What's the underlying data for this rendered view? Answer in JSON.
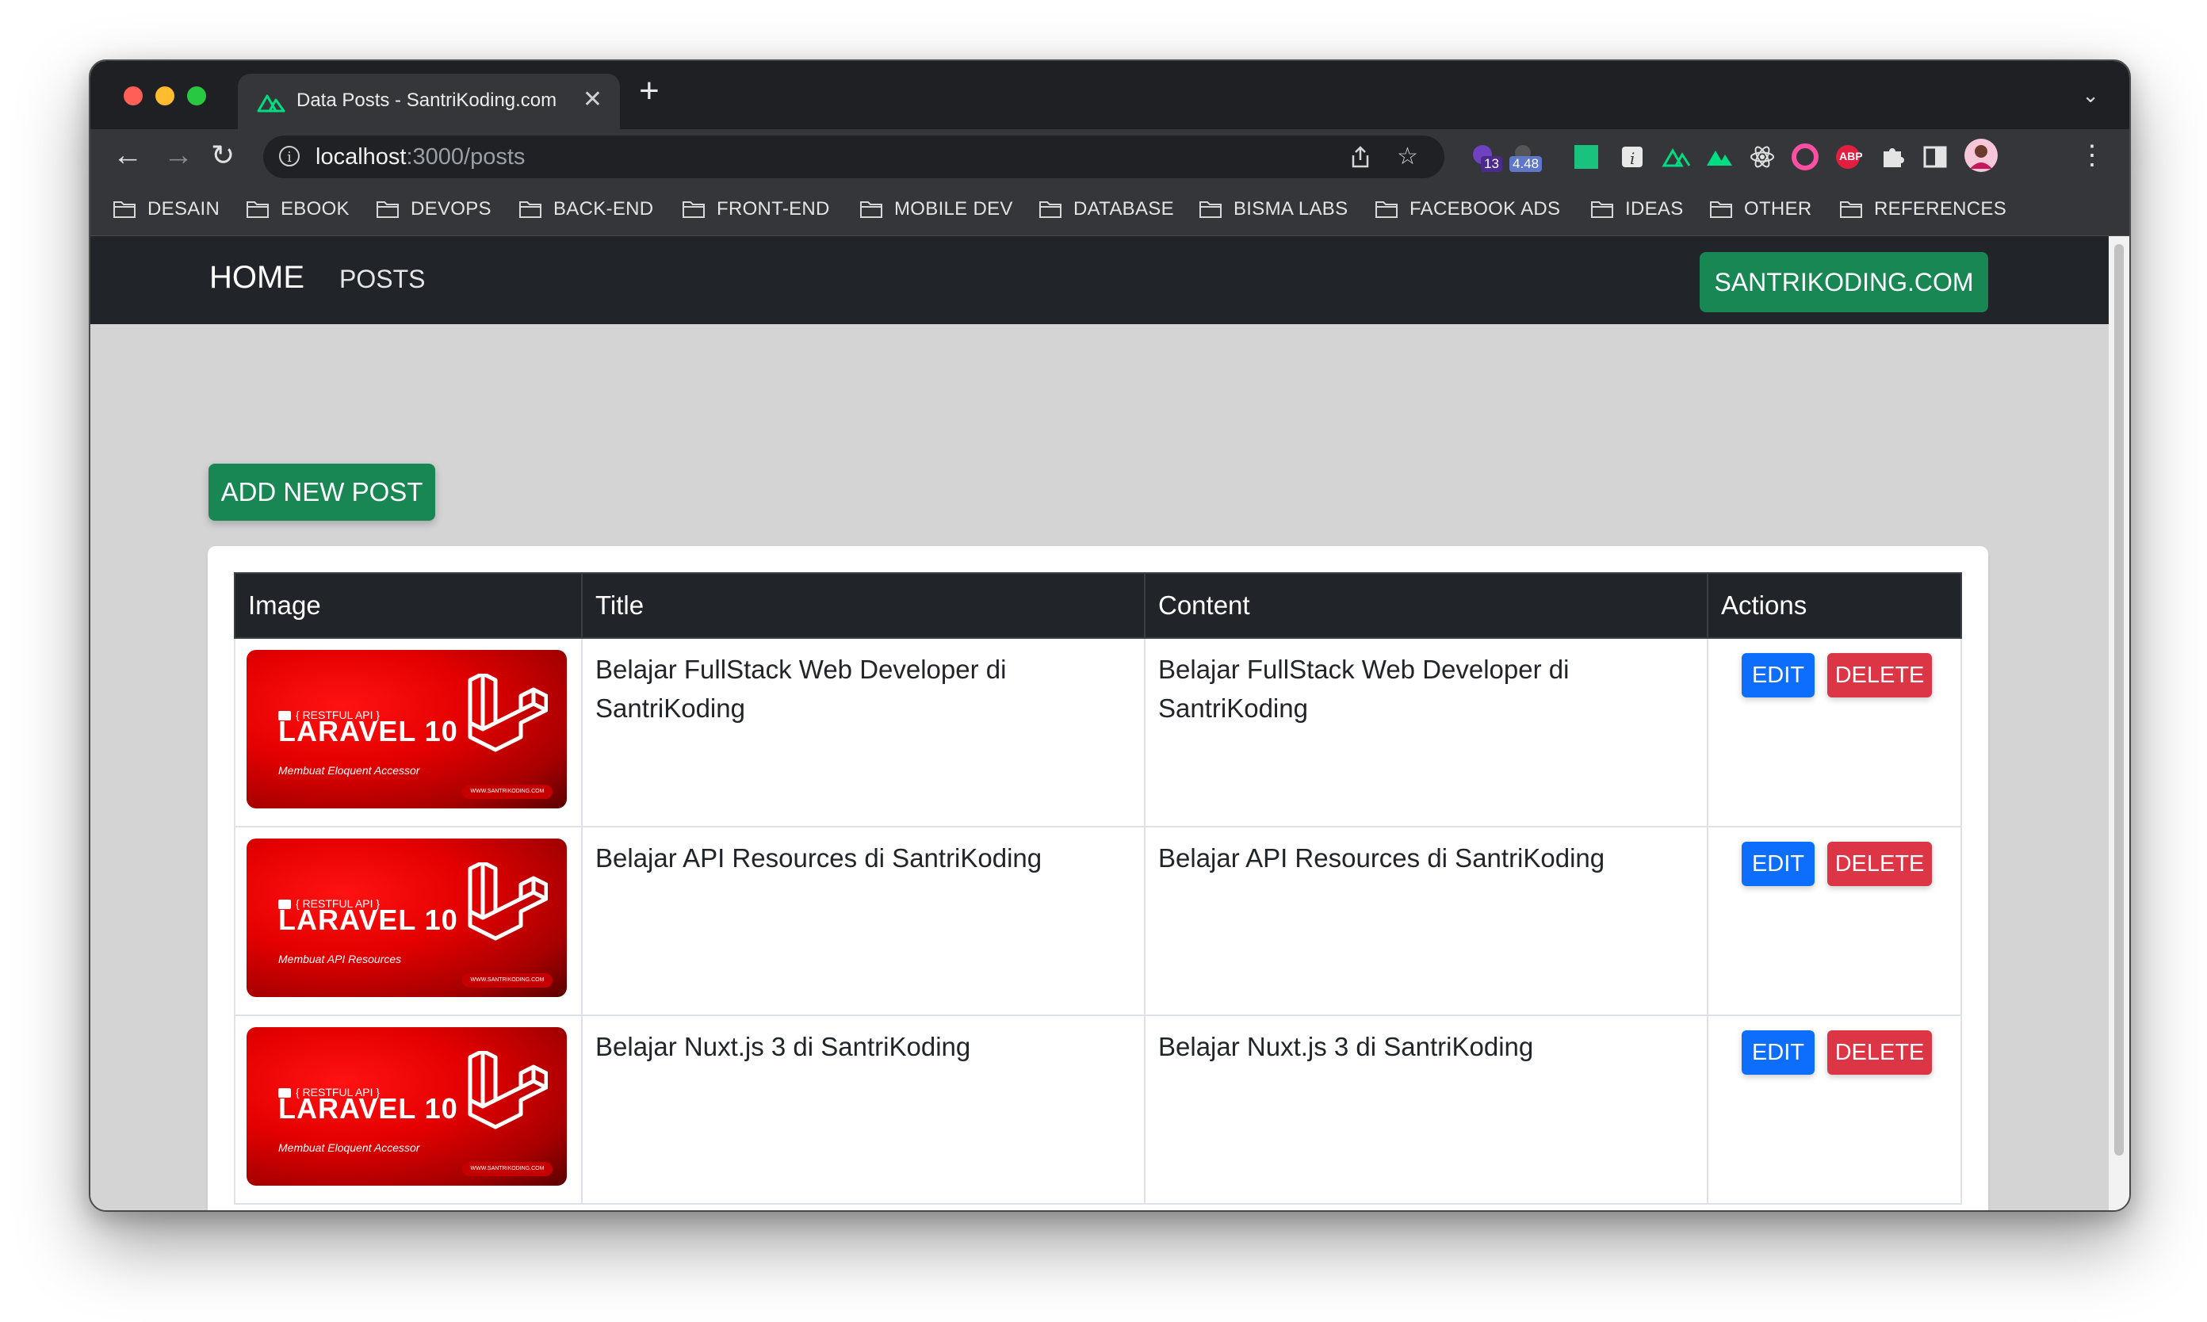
{
  "browser": {
    "tab_title": "Data Posts - SantriKoding.com",
    "tab_close": "✕",
    "new_tab": "+",
    "url_host": "localhost",
    "url_path": ":3000/posts",
    "extension_badge_count": "13",
    "extension_badge_value": "4.48",
    "abp_label": "ABP",
    "bookmarks": [
      "DESAIN",
      "EBOOK",
      "DEVOPS",
      "BACK-END",
      "FRONT-END",
      "MOBILE DEV",
      "DATABASE",
      "BISMA LABS",
      "FACEBOOK ADS",
      "IDEAS",
      "OTHER",
      "REFERENCES"
    ]
  },
  "nav": {
    "home": "HOME",
    "posts": "POSTS",
    "brand": "SANTRIKODING.COM"
  },
  "page": {
    "add_button": "ADD NEW POST"
  },
  "table": {
    "headers": [
      "Image",
      "Title",
      "Content",
      "Actions"
    ],
    "edit_label": "EDIT",
    "delete_label": "DELETE",
    "rows": [
      {
        "thumb_tag": "{ RESTFUL API }",
        "thumb_title": "LARAVEL 10",
        "thumb_sub": "Membuat Eloquent Accessor",
        "thumb_url": "WWW.SANTRIKODING.COM",
        "title": "Belajar FullStack Web Developer di SantriKoding",
        "content": "Belajar FullStack Web Developer di SantriKoding"
      },
      {
        "thumb_tag": "{ RESTFUL API }",
        "thumb_title": "LARAVEL 10",
        "thumb_sub": "Membuat API Resources",
        "thumb_url": "WWW.SANTRIKODING.COM",
        "title": "Belajar API Resources di SantriKoding",
        "content": "Belajar API Resources di SantriKoding"
      },
      {
        "thumb_tag": "{ RESTFUL API }",
        "thumb_title": "LARAVEL 10",
        "thumb_sub": "Membuat Eloquent Accessor",
        "thumb_url": "WWW.SANTRIKODING.COM",
        "title": "Belajar Nuxt.js 3 di SantriKoding",
        "content": "Belajar Nuxt.js 3 di SantriKoding"
      }
    ]
  },
  "colors": {
    "navbar": "#212529",
    "success": "#198754",
    "primary": "#0d6efd",
    "danger": "#dc3545",
    "page_bg": "#d4d4d4"
  }
}
